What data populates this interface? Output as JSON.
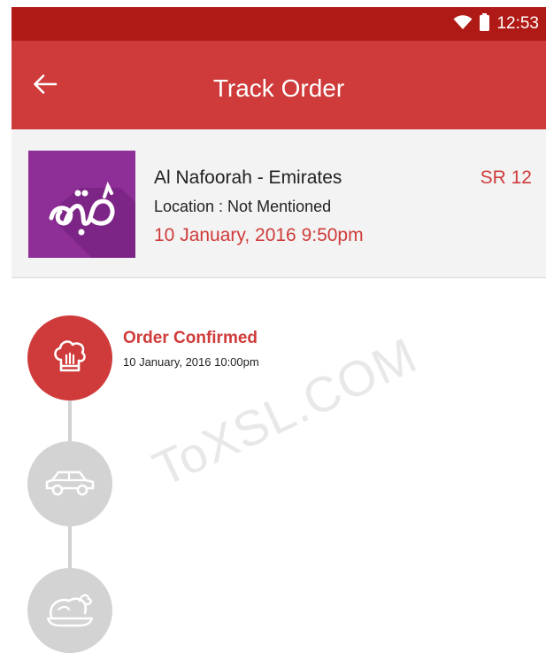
{
  "status_bar": {
    "time": "12:53",
    "icons": [
      "wifi-icon",
      "battery-icon"
    ]
  },
  "app_bar": {
    "title": "Track Order",
    "back_icon": "arrow-left-icon"
  },
  "order": {
    "restaurant_name": "Al Nafoorah - Emirates",
    "location": "Location : Not Mentioned",
    "date": "10 January, 2016 9:50pm",
    "price": "SR 12",
    "thumbnail_icon": "restaurant-logo"
  },
  "timeline": {
    "steps": [
      {
        "title": "Order Confirmed",
        "time": "10 January, 2016 10:00pm",
        "icon": "chef-hat-icon",
        "state": "active"
      },
      {
        "icon": "car-icon",
        "state": "pending"
      },
      {
        "icon": "roast-chicken-icon",
        "state": "pending"
      }
    ]
  },
  "watermark": "ToXSL.COM",
  "colors": {
    "status_bar": "#b01a16",
    "app_bar": "#cf3b3a",
    "accent": "#cf3b3a",
    "pending_step": "#d3d3d3",
    "thumbnail_bg": "#8e2e97"
  }
}
